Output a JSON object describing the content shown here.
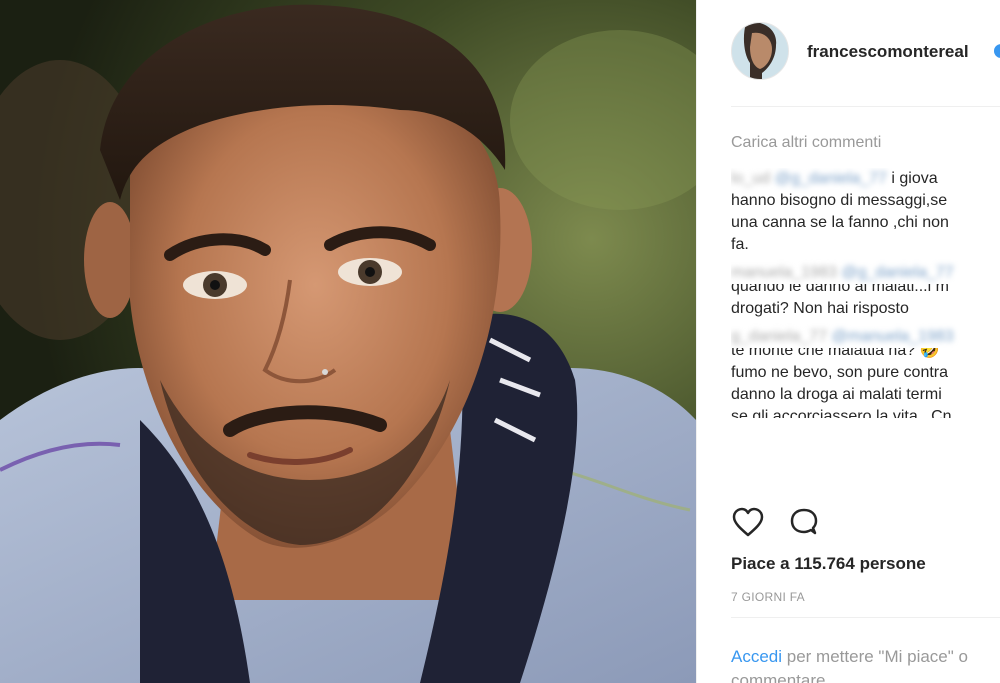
{
  "photo": {
    "alt_icon": "portrait-photo"
  },
  "post_header": {
    "username": "francescomontereal",
    "verified_icon": "verified-badge-icon"
  },
  "comments": {
    "load_more": "Carica altri commenti",
    "items": [
      {
        "author": "lo_ud",
        "mention": "@g_daniela_77",
        "lines": [
          "i giova",
          "hanno bisogno di messaggi,se",
          "una canna se la fanno ,chi non",
          "fa."
        ]
      },
      {
        "author": "manuela_1983",
        "mention": "@g_daniela_77",
        "lines": [
          "quando le danno ai malati...i m",
          "drogati? Non hai risposto"
        ]
      },
      {
        "author": "g_daniela_77",
        "mention": "@manuela_1983",
        "lines": [
          "te monte che malattia ha? 🤣",
          "fumo ne bevo, son pure contra",
          "danno la droga ai malati termi",
          "se gli accorciassero la vita.. Cn"
        ]
      }
    ]
  },
  "actions": {
    "like_icon": "heart-icon",
    "comment_icon": "comment-bubble-icon"
  },
  "likes": "Piace a 115.764 persone",
  "time": "7 GIORNI FA",
  "login": {
    "link": "Accedi",
    "text": "per mettere \"Mi piace\" o",
    "text2": "commentare"
  },
  "colors": {
    "link": "#3897f0",
    "muted": "#999999",
    "text": "#262626"
  }
}
